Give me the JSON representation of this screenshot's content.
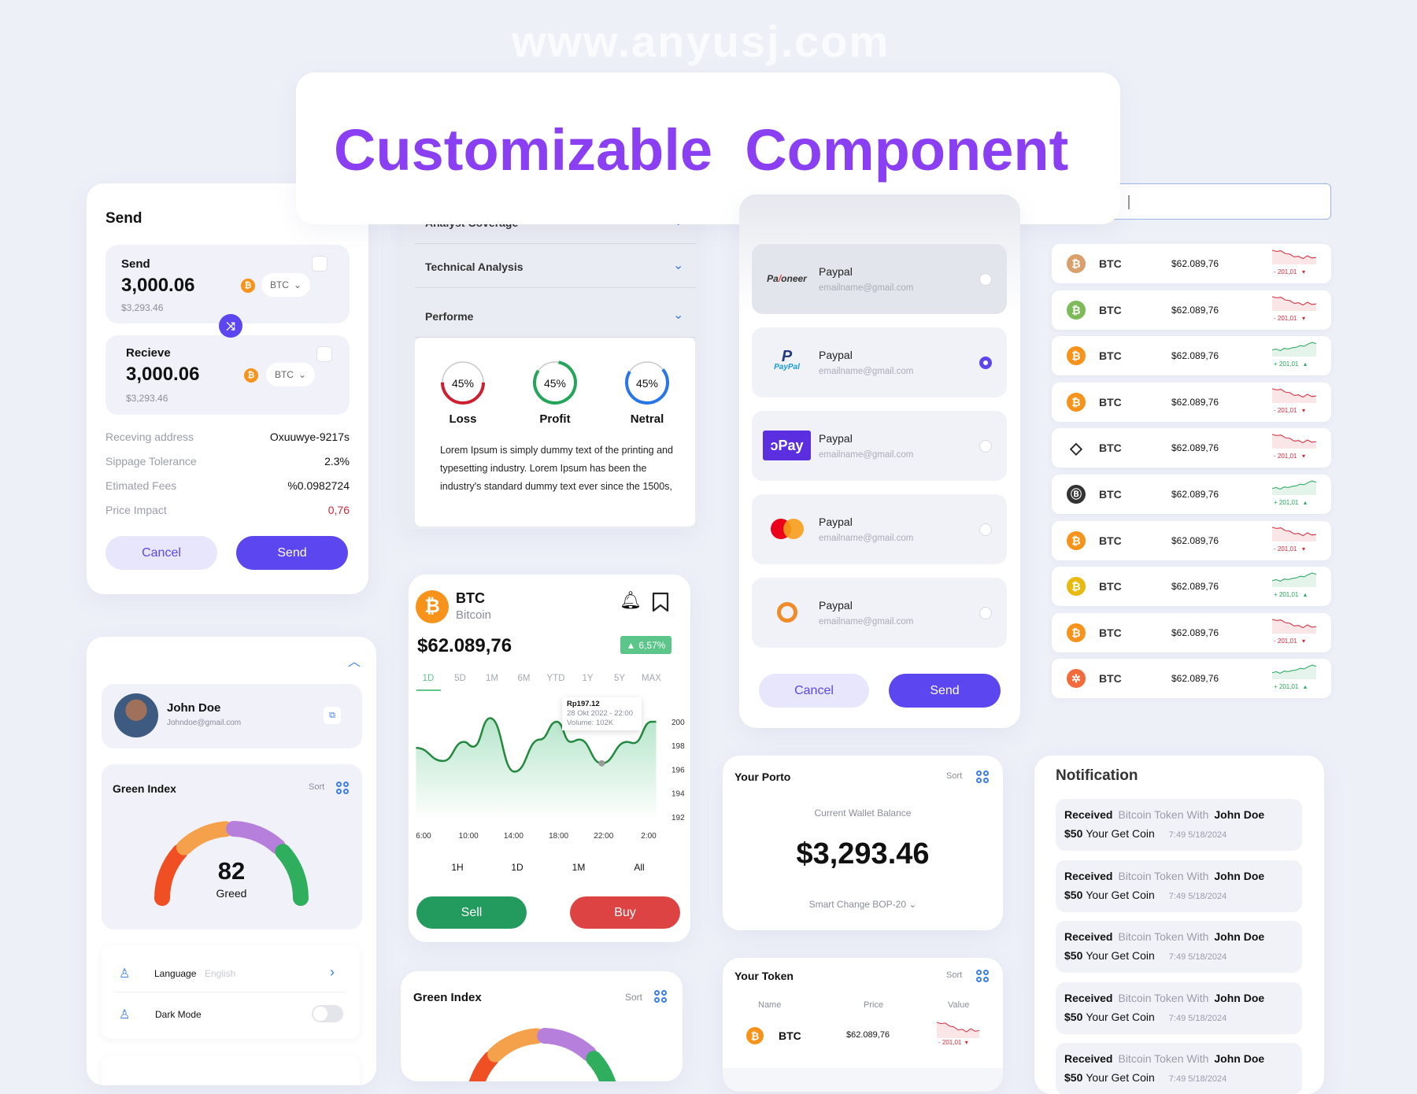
{
  "watermark": "www.anyusj.com",
  "title": "Customizable  Component",
  "colors": {
    "accent": "#5b46f0",
    "title": "#8a3ff2",
    "up": "#23a55a",
    "down": "#d3293a",
    "btc": "#f7931a"
  },
  "send_card": {
    "title": "Send",
    "send_box": {
      "label": "Send",
      "amount": "3,000.06",
      "usd": "$3,293.46",
      "currency": "BTC",
      "icon": "wallet-icon"
    },
    "receive_box": {
      "label": "Recieve",
      "amount": "3,000.06",
      "usd": "$3,293.46",
      "currency": "BTC",
      "icon": "wallet-icon"
    },
    "details": [
      {
        "label": "Receving address",
        "value": "Oxuuwye-9217s"
      },
      {
        "label": "Sippage Tolerance",
        "value": "2.3%"
      },
      {
        "label": "Etimated Fees",
        "value": "%0.0982724"
      },
      {
        "label": "Price Impact",
        "value": "0,76"
      }
    ],
    "cancel": "Cancel",
    "send": "Send"
  },
  "accordion": {
    "items": [
      "Analyst Coverage",
      "Technical Analysis",
      "Performe"
    ],
    "rings": [
      {
        "label": "Loss",
        "value": "45%",
        "fill_percent": 50,
        "color": "#cc1f2f"
      },
      {
        "label": "Profit",
        "value": "45%",
        "fill_percent": 82,
        "color": "#23a55a"
      },
      {
        "label": "Netral",
        "value": "45%",
        "fill_percent": 70,
        "color": "#2a76e8"
      }
    ],
    "text": "Lorem Ipsum is simply dummy text of the printing and typesetting industry. Lorem Ipsum has been the industry's standard dummy text ever since the 1500s,"
  },
  "btc_card": {
    "symbol": "BTC",
    "name": "Bitcoin",
    "price": "$62.089,76",
    "change": "6,57%",
    "ranges": [
      "1D",
      "5D",
      "1M",
      "6M",
      "YTD",
      "1Y",
      "5Y",
      "MAX"
    ],
    "active_range": "1D",
    "periods": [
      "1H",
      "1D",
      "1M",
      "All"
    ],
    "tooltip": {
      "value": "Rp197.12",
      "date": "28 Okt 2022 - 22:00",
      "volume": "Volume: 102K"
    },
    "sell": "Sell",
    "buy": "Buy"
  },
  "chart_data": {
    "type": "area",
    "x_ticks": [
      "6:00",
      "10:00",
      "14:00",
      "18:00",
      "22:00",
      "2:00"
    ],
    "y_ticks": [
      200,
      198,
      196,
      194,
      192
    ],
    "ylim": [
      192,
      200
    ],
    "grid": false,
    "x": [
      "5:20",
      "7:45",
      "9:35",
      "10:25",
      "11:55",
      "14:05",
      "16:20",
      "17:50",
      "19:05",
      "19:50",
      "21:50",
      "0:05",
      "0:40",
      "2:15",
      "2:40"
    ],
    "y": [
      197.8,
      196.7,
      198.3,
      197.9,
      200.3,
      195.8,
      198.5,
      200.0,
      198.3,
      198.5,
      196.5,
      198.3,
      198.2,
      200.0,
      200.0
    ],
    "highlight_index": 10,
    "color": "#23893f"
  },
  "profile": {
    "name": "John Doe",
    "email": "Johndoe@gmail.com"
  },
  "green_index": {
    "title": "Green Index",
    "sort": "Sort",
    "value": "82",
    "label": "Greed",
    "segment_colors": [
      "#f04e23",
      "#f5a04a",
      "#b57fdb",
      "#2fae5e"
    ]
  },
  "settings": [
    {
      "label": "Language",
      "value": "English"
    },
    {
      "label": "Dark Mode",
      "value": "",
      "toggle": false
    }
  ],
  "payments": {
    "methods": [
      {
        "logo": "Payoneer",
        "name": "Paypal",
        "email": "emailname@gmail.com",
        "selected": false
      },
      {
        "logo": "PayPal",
        "name": "Paypal",
        "email": "emailname@gmail.com",
        "selected": true
      },
      {
        "logo": "OPay",
        "name": "Paypal",
        "email": "emailname@gmail.com",
        "selected": false
      },
      {
        "logo": "mastercard",
        "name": "Paypal",
        "email": "emailname@gmail.com",
        "selected": false
      },
      {
        "logo": "qiwi",
        "name": "Paypal",
        "email": "emailname@gmail.com",
        "selected": false
      }
    ],
    "cancel": "Cancel",
    "send": "Send"
  },
  "search": {
    "value": ""
  },
  "crypto_list": [
    {
      "symbol": "BTC",
      "price": "$62.089,76",
      "change": "201,01",
      "trend": "down",
      "icon_color": "#d9a06b",
      "icon": "bitcoin-icon"
    },
    {
      "symbol": "BTC",
      "price": "$62.089,76",
      "change": "201,01",
      "trend": "down",
      "icon_color": "#7dbb5a",
      "icon": "bitcoin-icon"
    },
    {
      "symbol": "BTC",
      "price": "$62.089,76",
      "change": "201,01",
      "trend": "up",
      "icon_color": "#f7931a",
      "icon": "bitcoin-icon"
    },
    {
      "symbol": "BTC",
      "price": "$62.089,76",
      "change": "201,01",
      "trend": "down",
      "icon_color": "#f7931a",
      "icon": "bitcoin-icon"
    },
    {
      "symbol": "BTC",
      "price": "$62.089,76",
      "change": "201,01",
      "trend": "down",
      "icon_color": "#ffffff",
      "icon": "diamond-icon"
    },
    {
      "symbol": "BTC",
      "price": "$62.089,76",
      "change": "201,01",
      "trend": "up",
      "icon_color": "#333333",
      "icon": "bitcoin-b-icon"
    },
    {
      "symbol": "BTC",
      "price": "$62.089,76",
      "change": "201,01",
      "trend": "down",
      "icon_color": "#f7931a",
      "icon": "bitcoin-icon"
    },
    {
      "symbol": "BTC",
      "price": "$62.089,76",
      "change": "201,01",
      "trend": "up",
      "icon_color": "#e8b90f",
      "icon": "bitcoin-icon"
    },
    {
      "symbol": "BTC",
      "price": "$62.089,76",
      "change": "201,01",
      "trend": "down",
      "icon_color": "#f7931a",
      "icon": "bitcoin-icon"
    },
    {
      "symbol": "BTC",
      "price": "$62.089,76",
      "change": "201,01",
      "trend": "up",
      "icon_color": "#f26b3a",
      "icon": "star-coin-icon"
    }
  ],
  "porto": {
    "title": "Your Porto",
    "sort": "Sort",
    "balance_label": "Current Wallet Balance",
    "balance": "$3,293.46",
    "network": "Smart Change BOP-20"
  },
  "token": {
    "title": "Your Token",
    "sort": "Sort",
    "columns": [
      "Name",
      "Price",
      "Value"
    ],
    "rows": [
      {
        "symbol": "BTC",
        "price": "$62.089,76",
        "change": "201,01",
        "trend": "down"
      }
    ]
  },
  "notifications": {
    "title": "Notification",
    "items": [
      {
        "action": "Received",
        "text": "Bitcoin Token With",
        "who": "John Doe",
        "amount": "$50",
        "desc": "Your Get Coin",
        "time": "7:49 5/18/2024"
      },
      {
        "action": "Received",
        "text": "Bitcoin Token With",
        "who": "John Doe",
        "amount": "$50",
        "desc": "Your Get Coin",
        "time": "7:49 5/18/2024"
      },
      {
        "action": "Received",
        "text": "Bitcoin Token With",
        "who": "John Doe",
        "amount": "$50",
        "desc": "Your Get Coin",
        "time": "7:49 5/18/2024"
      },
      {
        "action": "Received",
        "text": "Bitcoin Token With",
        "who": "John Doe",
        "amount": "$50",
        "desc": "Your Get Coin",
        "time": "7:49 5/18/2024"
      },
      {
        "action": "Received",
        "text": "Bitcoin Token With",
        "who": "John Doe",
        "amount": "$50",
        "desc": "Your Get Coin",
        "time": "7:49 5/18/2024"
      }
    ]
  }
}
